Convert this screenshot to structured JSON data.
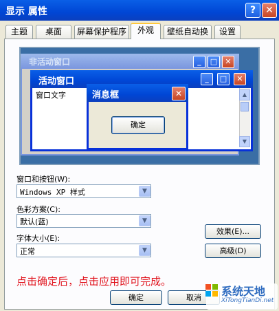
{
  "window": {
    "title": "显示 属性",
    "help": "?",
    "close": "✕"
  },
  "tabs": [
    "主题",
    "桌面",
    "屏幕保护程序",
    "外观",
    "壁纸自动换",
    "设置"
  ],
  "preview": {
    "inactive_title": "非活动窗口",
    "active_title": "活动窗口",
    "window_text": "窗口文字",
    "message_title": "消息框",
    "message_ok": "确定"
  },
  "form": {
    "window_buttons_label": "窗口和按钮(W):",
    "window_buttons_value": "Windows XP 样式",
    "color_scheme_label": "色彩方案(C):",
    "color_scheme_value": "默认(蓝)",
    "font_size_label": "字体大小(E):",
    "font_size_value": "正常",
    "effects_button": "效果(E)...",
    "advanced_button": "高级(D)"
  },
  "footer": {
    "ok": "确定",
    "cancel": "取消"
  },
  "note": "点击确定后，点击应用即可完成。",
  "watermark": {
    "name": "系统天地",
    "url": "XiTongTianDi.net"
  },
  "colors": {
    "xp_blue": "#0046D5",
    "note_red": "#E1141E",
    "dialog_bg": "#ECE9D8"
  }
}
